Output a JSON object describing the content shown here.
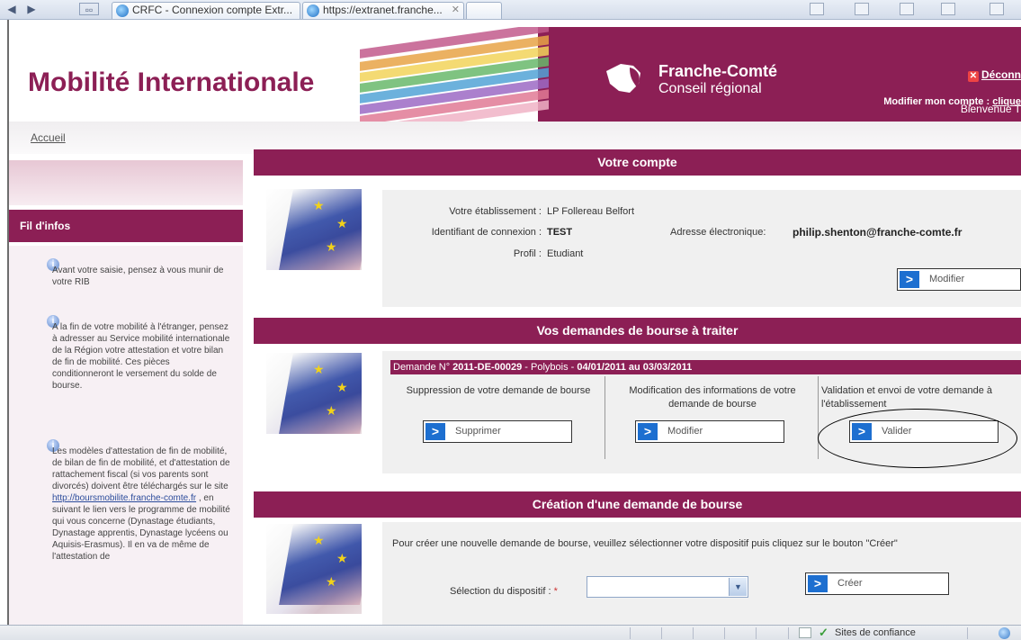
{
  "browser": {
    "tabs": [
      {
        "label": "CRFC - Connexion compte Extr..."
      },
      {
        "label": "https://extranet.franche..."
      }
    ]
  },
  "header": {
    "site_title": "Mobilité Internationale",
    "region_name": "Franche-Comté",
    "region_sub": "Conseil régional",
    "logout_label": "Déconn",
    "welcome": "Bienvenue T",
    "modify_label": "Modifier mon compte : ",
    "modify_link": "clique"
  },
  "breadcrumb": {
    "home": "Accueil"
  },
  "sidebar": {
    "title": "Fil d'infos",
    "news": [
      {
        "text": "Avant votre saisie, pensez à vous munir de votre RIB"
      },
      {
        "text": "A la fin de votre mobilité à l'étranger, pensez à adresser au Service mobilité internationale de la Région votre attestation et votre bilan de fin de mobilité. Ces pièces conditionneront le versement du solde de bourse."
      },
      {
        "text_before": "Les modèles d'attestation de fin de mobilité, de bilan de fin de mobilité, et d'attestation de rattachement fiscal (si vos parents sont divorcés) doivent être téléchargés sur le site ",
        "link": "http://boursmobilite.franche-comte.fr",
        "text_after": " , en suivant le lien vers le programme de mobilité qui vous concerne (Dynastage étudiants, Dynastage apprentis, Dynastage lycéens ou Aquisis-Erasmus). Il en va de même de l'attestation de"
      }
    ]
  },
  "account": {
    "section_title": "Votre compte",
    "etablissement_label": "Votre établissement :",
    "etablissement_value": "LP Follereau Belfort",
    "identifiant_label": "Identifiant de connexion :",
    "identifiant_value": "TEST",
    "profil_label": "Profil :",
    "profil_value": "Etudiant",
    "email_label": "Adresse électronique:",
    "email_value": "philip.shenton@franche-comte.fr",
    "modify_button": "Modifier"
  },
  "requests": {
    "section_title": "Vos demandes de bourse à traiter",
    "demande_prefix": "Demande N° ",
    "demande_number": "2011-DE-00029",
    "demande_mid": " - Polybois - ",
    "demande_dates": "04/01/2011 au 03/03/2011",
    "col1_text": "Suppression de votre demande de bourse",
    "col1_button": "Supprimer",
    "col2_text": "Modification des informations de votre demande de bourse",
    "col2_button": "Modifier",
    "col3_text": "Validation et envoi de votre demande à l'établissement",
    "col3_button": "Valider"
  },
  "creation": {
    "section_title": "Création d'une demande de bourse",
    "instruction": "Pour créer une nouvelle demande de bourse, veuillez sélectionner votre dispositif puis cliquez sur le bouton \"Créer\"",
    "select_label": "Sélection du dispositif : ",
    "required_mark": "*",
    "select_value": "",
    "create_button": "Créer"
  },
  "statusbar": {
    "zone": "Sites de confiance"
  },
  "colors": {
    "brand": "#8c1f55",
    "button_arrow": "#1d6fd0"
  }
}
